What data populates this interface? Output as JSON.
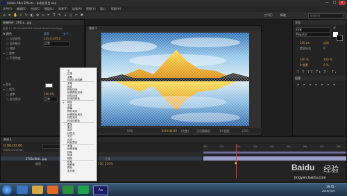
{
  "app": {
    "title": "Adobe After Effects - 未命名项目.aep"
  },
  "window": {
    "minimize": "—",
    "maximize": "□",
    "close": "✕"
  },
  "menu": [
    "文件(F)",
    "编辑(E)",
    "合成(C)",
    "图层(L)",
    "效果(T)",
    "动画(A)",
    "视图(V)",
    "窗口",
    "帮助(H)"
  ],
  "toolbar": {
    "workspace_label": "工作区:",
    "workspace_value": "标准",
    "search_placeholder": "搜索帮助"
  },
  "effect_controls": {
    "tab": "效果控件: 3701e...jpg",
    "path": "合成 1 • 3701e0b0052174c0a5f4c0b07a4c5.jpg",
    "rows": [
      {
        "label": "fx  颜色",
        "value": "重置",
        "extra": "关于..."
      },
      {
        "label": "○ 当前颜色",
        "value": "145.0,145.0"
      },
      {
        "label": "○ 混合模式",
        "value": "正常"
      },
      {
        "label": "○ 缩放",
        "value": ""
      },
      {
        "label": "▸ ○ 旋转",
        "value": "100.0%"
      },
      {
        "label": "○ 不透明度",
        "value": ""
      },
      {
        "label": "▸ 颜色",
        "value": ""
      },
      {
        "label": "▸ ○ 颜色",
        "value": ""
      },
      {
        "label": "○ 遮罩",
        "value": ""
      },
      {
        "label": "○ 混合模式",
        "value": "正常"
      }
    ]
  },
  "viewer": {
    "tab": "合成 1",
    "bottom_bar": {
      "zoom": "50%",
      "timecode": "0:00:00:00",
      "res": "(完整)",
      "camera": "活动摄像机",
      "views": "1个视图",
      "offset": "+0.0"
    }
  },
  "context_menu": {
    "items": [
      {
        "label": "无",
        "checked": false,
        "sep_after": false
      },
      {
        "label": "正常",
        "checked": false,
        "sep_after": false
      },
      {
        "label": "溶解",
        "checked": false,
        "sep_after": false
      },
      {
        "label": "动态抖动溶解",
        "checked": false,
        "sep_after": true
      },
      {
        "label": "变暗",
        "checked": false,
        "sep_after": false
      },
      {
        "label": "相乘",
        "checked": false,
        "sep_after": false
      },
      {
        "label": "颜色加深",
        "checked": false,
        "sep_after": false
      },
      {
        "label": "经典颜色加深",
        "checked": false,
        "sep_after": false
      },
      {
        "label": "线性加深",
        "checked": false,
        "sep_after": false
      },
      {
        "label": "较深的颜色",
        "checked": false,
        "sep_after": true
      },
      {
        "label": "相加",
        "checked": true,
        "sep_after": false
      },
      {
        "label": "变亮",
        "checked": false,
        "sep_after": false
      },
      {
        "label": "屏幕",
        "checked": false,
        "sep_after": false
      },
      {
        "label": "颜色减淡",
        "checked": false,
        "sep_after": false
      },
      {
        "label": "经典颜色减淡",
        "checked": false,
        "sep_after": false
      },
      {
        "label": "线性减淡",
        "checked": false,
        "sep_after": false
      },
      {
        "label": "较浅的颜色",
        "checked": false,
        "sep_after": true
      },
      {
        "label": "叠加",
        "checked": false,
        "sep_after": false
      },
      {
        "label": "柔光",
        "checked": false,
        "sep_after": false
      },
      {
        "label": "强光",
        "checked": false,
        "sep_after": false
      },
      {
        "label": "线性光",
        "checked": false,
        "sep_after": false
      },
      {
        "label": "亮光",
        "checked": false,
        "sep_after": false
      },
      {
        "label": "点光",
        "checked": false,
        "sep_after": false
      },
      {
        "label": "纯色混合",
        "checked": false,
        "sep_after": true
      },
      {
        "label": "差值",
        "checked": false,
        "sep_after": false
      },
      {
        "label": "经典差值",
        "checked": false,
        "sep_after": false
      },
      {
        "label": "排除",
        "checked": false,
        "sep_after": false
      },
      {
        "label": "相减",
        "checked": false,
        "sep_after": false
      },
      {
        "label": "相除",
        "checked": false,
        "sep_after": true
      },
      {
        "label": "色相",
        "checked": false,
        "sep_after": false
      },
      {
        "label": "饱和度",
        "checked": false,
        "sep_after": false
      },
      {
        "label": "颜色",
        "checked": false,
        "sep_after": false
      },
      {
        "label": "发光度",
        "checked": false,
        "sep_after": false
      }
    ]
  },
  "right_panel": {
    "tab": "字符",
    "font": "仿宋",
    "style": "Regular",
    "rows": [
      "100 px",
      "自动",
      "度量标准",
      "0",
      "100 %",
      "100 %",
      "0 像素",
      "0 %"
    ],
    "para_tab": "段落"
  },
  "timeline": {
    "tab": "合成 1",
    "timecode": "0:00:00:00",
    "fps": "00000 (25.00 fps)",
    "layer": "3701e0b0...jpg",
    "sub": "缩放",
    "value": "210, 210%",
    "mode": "正常",
    "ruler": [
      "00s",
      "01s",
      "02s",
      "03s",
      "04s",
      "05s",
      "06s",
      "07s",
      "08s"
    ]
  },
  "taskbar": {
    "clock_time": "19:45",
    "clock_date": "2019/7/19"
  },
  "watermark": {
    "brand": "Baidu",
    "cn": "经验",
    "url": "jingyan.baidu.com"
  },
  "colors": {
    "accent": "#d9a04b",
    "panel": "#232323",
    "taskbar": "#2b4863"
  }
}
